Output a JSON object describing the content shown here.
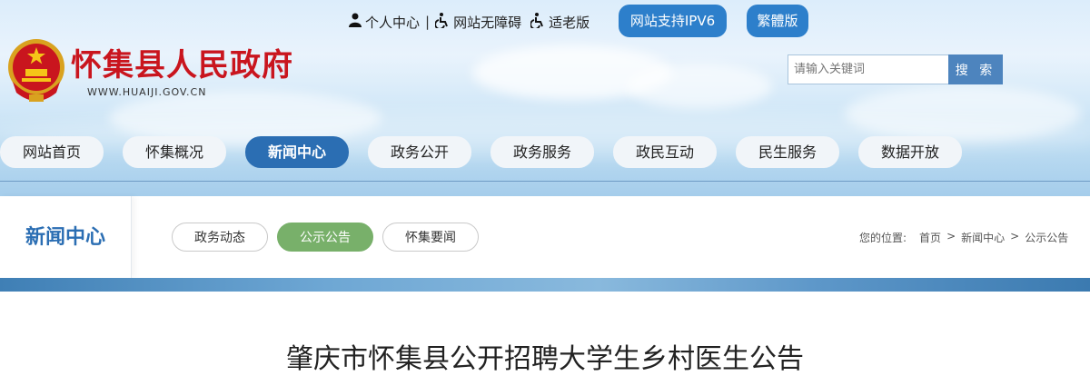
{
  "header": {
    "top_links": [
      {
        "icon": "person-icon",
        "label": "个人中心"
      },
      {
        "icon": "accessibility-icon",
        "label": "网站无障碍"
      },
      {
        "icon": "accessibility-icon",
        "label": "适老版"
      }
    ],
    "separator": "|",
    "ipv6_label": "网站支持IPV6",
    "traditional_label": "繁體版",
    "site_name": "怀集县人民政府",
    "site_url": "WWW.HUAIJI.GOV.CN",
    "search": {
      "placeholder": "请输入关键词",
      "button_label": "搜 索"
    }
  },
  "nav": {
    "items": [
      "网站首页",
      "怀集概况",
      "新闻中心",
      "政务公开",
      "政务服务",
      "政民互动",
      "民生服务",
      "数据开放"
    ],
    "active_index": 2
  },
  "section": {
    "title": "新闻中心",
    "tabs": [
      "政务动态",
      "公示公告",
      "怀集要闻"
    ],
    "active_tab_index": 1,
    "breadcrumb": {
      "prefix": "您的位置:",
      "items": [
        "首页",
        "新闻中心",
        "公示公告"
      ],
      "separator": ">"
    }
  },
  "article": {
    "title": "肇庆市怀集县公开招聘大学生乡村医生公告"
  },
  "colors": {
    "primary_blue": "#2b6eb3",
    "site_name_red": "#c9151e",
    "active_tab_green": "#78b06a",
    "search_button": "#4d84be"
  }
}
